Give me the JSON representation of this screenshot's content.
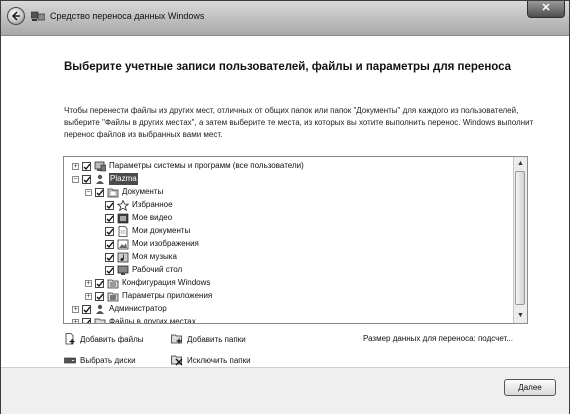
{
  "window": {
    "title": "Средство переноса данных Windows",
    "close_glyph": "✕"
  },
  "heading": "Выберите учетные записи пользователей, файлы и параметры для переноса",
  "description": "Чтобы перенести файлы из других мест, отличных от общих папок или папок \"Документы\" для каждого из пользователей, выберите \"Файлы в других местах\", а затем выберите те места, из которых вы хотите выполнить перенос. Windows выполнит перенос файлов из выбранных вами мест.",
  "tree": {
    "items": [
      {
        "label": "Параметры системы и программ (все пользователи)",
        "expander": "+",
        "checked": true,
        "icon": "system-settings-icon"
      },
      {
        "label": "Plazma",
        "expander": "−",
        "checked": true,
        "icon": "user-icon",
        "selected": true
      },
      {
        "label": "Документы",
        "expander": "−",
        "checked": true,
        "icon": "documents-folder-icon"
      },
      {
        "label": "Избранное",
        "checked": true,
        "icon": "favorites-star-icon"
      },
      {
        "label": "Мое видео",
        "checked": true,
        "icon": "video-icon"
      },
      {
        "label": "Мои документы",
        "checked": true,
        "icon": "document-icon"
      },
      {
        "label": "Мои изображения",
        "checked": true,
        "icon": "pictures-icon"
      },
      {
        "label": "Моя музыка",
        "checked": true,
        "icon": "music-icon"
      },
      {
        "label": "Рабочий стол",
        "checked": true,
        "icon": "desktop-icon"
      },
      {
        "label": "Конфигурация Windows",
        "expander": "+",
        "checked": true,
        "icon": "config-folder-icon"
      },
      {
        "label": "Параметры приложения",
        "expander": "+",
        "checked": true,
        "icon": "app-settings-folder-icon"
      },
      {
        "label": "Администратор",
        "expander": "+",
        "checked": true,
        "icon": "user-icon"
      },
      {
        "label": "Файлы в других местах",
        "expander": "+",
        "checked": true,
        "icon": "files-folder-icon"
      }
    ]
  },
  "actions": {
    "add_files": "Добавить файлы",
    "add_folders": "Добавить папки",
    "select_disks": "Выбрать диски",
    "exclude_folders": "Исключить папки"
  },
  "size_label": "Размер данных для переноса: подсчет...",
  "next_button": "Далее"
}
